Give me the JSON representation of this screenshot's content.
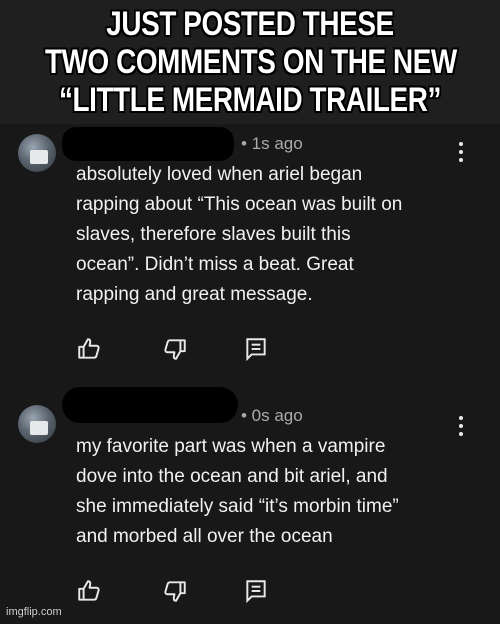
{
  "caption": {
    "line1": "JUST POSTED THESE",
    "line2": "TWO COMMENTS ON THE NEW",
    "line3": "“LITTLE MERMAID TRAILER”"
  },
  "comments": [
    {
      "time": "• 1s ago",
      "text": "absolutely loved when ariel began\nrapping about “This ocean was built on\nslaves, therefore slaves built this\nocean”. Didn’t miss a beat. Great\nrapping and great message."
    },
    {
      "time": "• 0s ago",
      "text": "my favorite part was when a vampire\ndove into the ocean and bit ariel, and\nshe immediately said “it’s morbin time”\nand morbed all over the ocean"
    }
  ],
  "icons": {
    "like": "thumbs-up-icon",
    "dislike": "thumbs-down-icon",
    "reply": "reply-icon",
    "more": "more-vert-icon"
  },
  "colors": {
    "background": "#181818",
    "text": "#f1f1f1",
    "muted": "#aaaaaa"
  },
  "watermark": "imgflip.com"
}
